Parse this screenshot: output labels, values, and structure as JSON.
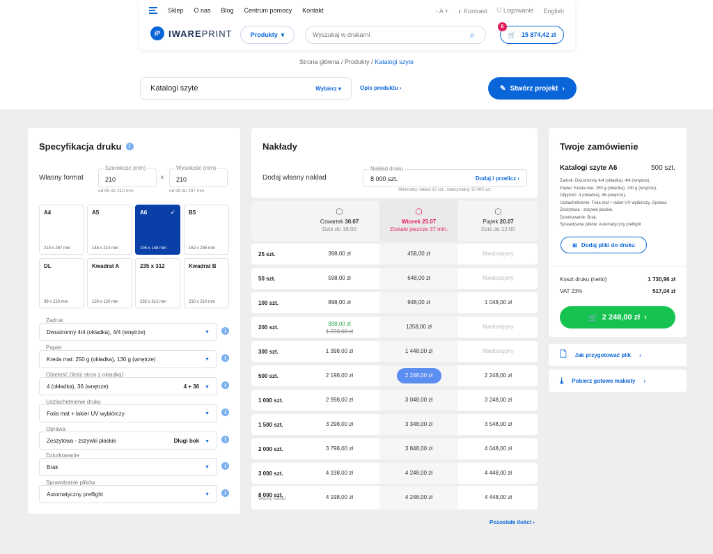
{
  "header": {
    "nav": [
      "Sklep",
      "O nas",
      "Blog",
      "Centrum pomocy",
      "Kontakt"
    ],
    "font_size": "- A +",
    "contrast": "Kontrast",
    "login": "Logowanie",
    "language": "English",
    "logo_mark": "iP",
    "logo_bold": "IWARE",
    "logo_light": "PRINT",
    "products_button": "Produkty",
    "search_placeholder": "Wyszukaj w drukarni",
    "cart_total": "15 874,42 zł",
    "cart_count": "6"
  },
  "breadcrumb": {
    "home": "Strona główna",
    "sep1": "/",
    "products": "Produkty",
    "sep2": "/",
    "current": "Katalogi szyte"
  },
  "product_select": {
    "value": "Katalogi szyte",
    "choose": "Wybierz",
    "description_link": "Opis produktu"
  },
  "create_button": "Stwórz projekt",
  "spec": {
    "title": "Specyfikacja druku",
    "own_format": "Własny format",
    "width_label": "Szerokość (mm)",
    "width_value": "210",
    "width_hint": "od 85 do 210 mm",
    "times": "x",
    "height_label": "Wysokość (mm)",
    "height_value": "210",
    "height_hint": "od 99 do 297 mm",
    "formats": [
      {
        "name": "A4",
        "dims": "210 x 297 mm"
      },
      {
        "name": "A5",
        "dims": "148 x 210 mm"
      },
      {
        "name": "A6",
        "dims": "105 x 148 mm"
      },
      {
        "name": "B5",
        "dims": "162 x 235 mm"
      },
      {
        "name": "DL",
        "dims": "99 x 210 mm"
      },
      {
        "name": "Kwadrat A",
        "dims": "120 x 120 mm"
      },
      {
        "name": "235 x 312",
        "dims": "235 x 312 mm"
      },
      {
        "name": "Kwadrat B",
        "dims": "210 x 210 mm"
      }
    ],
    "selected_format": "A6",
    "options": [
      {
        "label": "Zadruk",
        "value": "Dwustronny 4/4 (okładka), 4/4 (wnętrze)",
        "right": ""
      },
      {
        "label": "Papier",
        "value": "Kreda mat: 250 g (okładka), 130 g (wnętrze)",
        "right": ""
      },
      {
        "label": "Objętość (ilość stron z okładką)",
        "value": "4 (okładka), 36 (wnętrze)",
        "right": "4 + 36"
      },
      {
        "label": "Uszlachetnienie druku",
        "value": "Folia mat + lakier UV wybiórczy",
        "right": ""
      },
      {
        "label": "Oprawa",
        "value": "Zeszytowa - zszywki płaskie",
        "right": "Długi bok"
      },
      {
        "label": "Dziurkowanie",
        "value": "Brak",
        "right": ""
      },
      {
        "label": "Sprawdzanie plików",
        "value": "Automatyczny preflight",
        "right": ""
      }
    ]
  },
  "naklady": {
    "title": "Nakłady",
    "own_label": "Dodaj własny nakład",
    "field_label": "Nakład druku",
    "field_value": "8 000 szt.",
    "apply": "Dodaj i przelicz",
    "hint": "Minimalny nakład 10 szt., maksymalny 10 000 szt.",
    "days": [
      {
        "day": "Czwartek",
        "date": "30.07",
        "sub": "Dziś do 16:00"
      },
      {
        "day": "Wtorek",
        "date": "25.07",
        "sub": "Zostało jeszcze 37 min."
      },
      {
        "day": "Piątek",
        "date": "20.07",
        "sub": "Dziś do 12:00"
      }
    ],
    "rows": [
      {
        "q": "25 szt.",
        "a": "398,00 zł",
        "b": "458,00 zł",
        "c": "Niedostępny"
      },
      {
        "q": "50 szt.",
        "a": "598,00 zł",
        "b": "648,00 zł",
        "c": "Niedostępny"
      },
      {
        "q": "100 szt.",
        "a": "898,00 zł",
        "b": "948,00 zł",
        "c": "1 048,00 zł"
      },
      {
        "q": "200 szt.",
        "a": "998,00 zł",
        "a_old": "1 270,00 zł",
        "b": "1358,00 zł",
        "c": "Niedostępny"
      },
      {
        "q": "300 szt.",
        "a": "1 398,00 zł",
        "b": "1 448,00 zł",
        "c": "Niedostępny"
      },
      {
        "q": "500 szt.",
        "a": "2 198,00 zł",
        "b": "2 248,00 zł",
        "c": "2 248,00 zł"
      },
      {
        "q": "1 000 szt.",
        "a": "2 998,00 zł",
        "b": "3 048,00 zł",
        "c": "3 248,00 zł"
      },
      {
        "q": "1 500 szt.",
        "a": "3 298,00 zł",
        "b": "3 348,00 zł",
        "c": "3 548,00 zł"
      },
      {
        "q": "2 000 szt.",
        "a": "3 798,00 zł",
        "b": "3 848,00 zł",
        "c": "4 048,00 zł"
      },
      {
        "q": "3 000 szt.",
        "a": "4 198,00 zł",
        "b": "4 248,00 zł",
        "c": "4 448,00 zł"
      },
      {
        "q": "8 000 szt.",
        "sub": "Własny nakład",
        "a": "4 198,00 zł",
        "b": "4 248,00 zł",
        "c": "4 448,00 zł"
      }
    ],
    "more": "Pozostałe ilości"
  },
  "order": {
    "title": "Twoje zamówienie",
    "product": "Katalogi szyte A6",
    "qty": "500 szt.",
    "details": [
      "Zadruk: Dwustronny 4/4 (okładka), 4/4 (wnętrze),",
      "Papier: Kreda mat: 250 g (okładka), 130 g (wnętrze),",
      "Objętość: 4 (okładka), 36 (wnętrze),",
      "Uszlachetnienie: Folia mat + lakier UV wybiórczy, Oprawa",
      "Zeszytowa - zszywki płaskie,",
      "Dziurkowanie: Brak,",
      "Sprawdzanie plików: Automatyczny preflight"
    ],
    "upload": "Dodaj pliki do druku",
    "cost_label": "Koszt druku (netto)",
    "cost_value": "1 730,96 zł",
    "vat_label": "VAT 23%",
    "vat_value": "517,04 zł",
    "buy": "2 248,00 zł"
  },
  "links": {
    "prepare": "Jak przygotować plik",
    "templates": "Pobierz gotowe makiety"
  }
}
